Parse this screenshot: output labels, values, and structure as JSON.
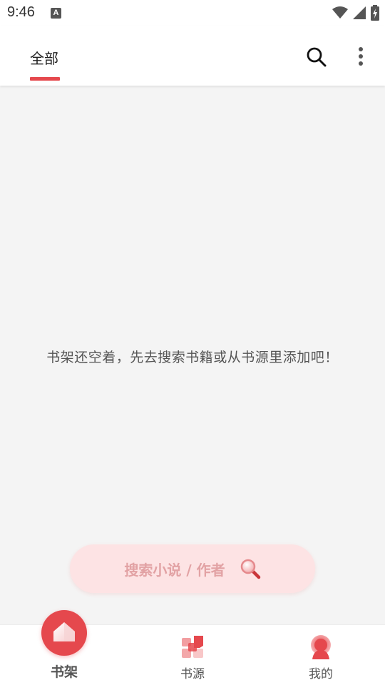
{
  "status_bar": {
    "time": "9:46",
    "notification_icon": "a-letter-icon",
    "notification_letter": "A",
    "icons": [
      "wifi-icon",
      "cell-signal-icon",
      "battery-icon"
    ]
  },
  "header": {
    "tabs": [
      {
        "label": "全部",
        "active": true
      }
    ],
    "actions": [
      "search-icon",
      "more-vert-icon"
    ]
  },
  "main": {
    "empty_message": "书架还空着，先去搜索书籍或从书源里添加吧！",
    "search_button": {
      "label": "搜索小说 / 作者",
      "icon": "magnifier-icon"
    }
  },
  "bottom_nav": {
    "items": [
      {
        "label": "书架",
        "icon": "bookshelf-house-icon",
        "active": true
      },
      {
        "label": "书源",
        "icon": "sources-grid-icon",
        "active": false
      },
      {
        "label": "我的",
        "icon": "profile-badge-icon",
        "active": false
      }
    ]
  },
  "colors": {
    "accent": "#e5484d",
    "accent_light": "#fde3e4",
    "background": "#f4f4f4",
    "surface": "#ffffff"
  }
}
